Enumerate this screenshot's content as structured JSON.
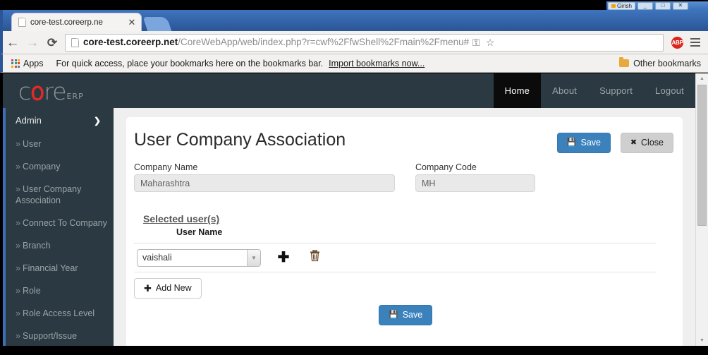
{
  "os": {
    "user_label": "Girish",
    "minimize_label": "_",
    "maximize_label": "□",
    "close_label": "✕"
  },
  "browser": {
    "tab": {
      "title": "core-test.coreerp.ne",
      "close_label": "✕"
    },
    "nav": {
      "back": "←",
      "forward": "→",
      "reload": "⟳"
    },
    "omnibox": {
      "host": "core-test.coreerp.net",
      "path": "/CoreWebApp/web/index.php?r=cwf%2FfwShell%2Fmain%2Fmenu#",
      "key_icon": "⚿",
      "star_icon": "☆",
      "abp_label": "ABP"
    },
    "bookmarks": {
      "apps_label": "Apps",
      "hint": "For quick access, place your bookmarks here on the bookmarks bar.",
      "import_label": "Import bookmarks now...",
      "other_label": "Other bookmarks"
    }
  },
  "app": {
    "logo": {
      "part1": "c",
      "part2": "o",
      "part3": "re",
      "suffix": "ERP"
    },
    "topnav": [
      {
        "label": "Home",
        "active": true
      },
      {
        "label": "About",
        "active": false
      },
      {
        "label": "Support",
        "active": false
      },
      {
        "label": "Logout",
        "active": false
      }
    ],
    "sidebar": {
      "header": "Admin",
      "chevron": "❯",
      "items": [
        {
          "label": "User"
        },
        {
          "label": "Company"
        },
        {
          "label": "User Company Association"
        },
        {
          "label": "Connect To Company"
        },
        {
          "label": "Branch"
        },
        {
          "label": "Financial Year"
        },
        {
          "label": "Role"
        },
        {
          "label": "Role Access Level"
        },
        {
          "label": "Support/Issue"
        }
      ],
      "marker": "»"
    },
    "page": {
      "title": "User Company Association",
      "save_top_label": "Save",
      "close_top_label": "Close",
      "fields": {
        "company_name_label": "Company Name",
        "company_name_value": "Maharashtra",
        "company_code_label": "Company Code",
        "company_code_value": "MH"
      },
      "selected_users": {
        "heading": "Selected user(s)",
        "column_header": "User Name",
        "rows": [
          {
            "user": "vaishali",
            "add_icon": "➕",
            "delete_icon": "🗑"
          }
        ]
      },
      "add_new_label": "Add New",
      "save_bottom_label": "Save",
      "plus_glyph": "✚",
      "save_glyph": "💾",
      "close_glyph": "✖"
    },
    "colors": {
      "header_bg": "#2b3a42",
      "accent_blue": "#3b82bd",
      "logo_red": "#e02a26",
      "page_bg": "#efefef"
    }
  },
  "scrollbar": {
    "up_arrow": "▲",
    "down_arrow": "▼"
  }
}
